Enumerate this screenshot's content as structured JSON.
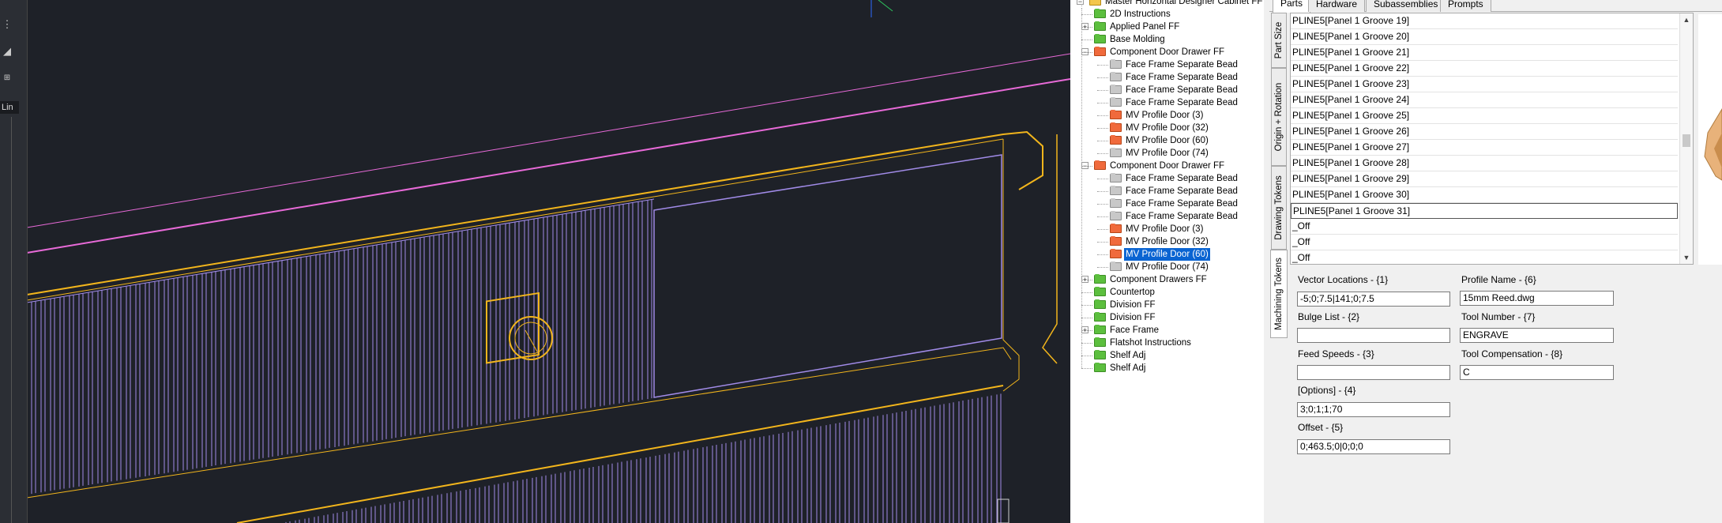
{
  "cad": {
    "linetype_label": "Lin"
  },
  "tree": {
    "root": "Master Horizontal Designer Cabinet FF",
    "nodes": [
      {
        "label": "2D Instructions",
        "color": "green",
        "expander": ""
      },
      {
        "label": "Applied Panel FF",
        "color": "green",
        "expander": "+"
      },
      {
        "label": "Base Molding",
        "color": "green",
        "expander": ""
      },
      {
        "label": "Component Door Drawer FF",
        "color": "red",
        "expander": "-"
      },
      {
        "label": "Face Frame Separate Bead",
        "color": "grey",
        "expander": ""
      },
      {
        "label": "Face Frame Separate Bead",
        "color": "grey",
        "expander": ""
      },
      {
        "label": "Face Frame Separate Bead",
        "color": "grey",
        "expander": ""
      },
      {
        "label": "Face Frame Separate Bead",
        "color": "grey",
        "expander": ""
      },
      {
        "label": "MV Profile Door (3)",
        "color": "red",
        "expander": ""
      },
      {
        "label": "MV Profile Door (32)",
        "color": "red",
        "expander": ""
      },
      {
        "label": "MV Profile Door (60)",
        "color": "red",
        "expander": ""
      },
      {
        "label": "MV Profile Door (74)",
        "color": "grey",
        "expander": ""
      },
      {
        "label": "Component Door Drawer FF",
        "color": "red",
        "expander": "-"
      },
      {
        "label": "Face Frame Separate Bead",
        "color": "grey",
        "expander": ""
      },
      {
        "label": "Face Frame Separate Bead",
        "color": "grey",
        "expander": ""
      },
      {
        "label": "Face Frame Separate Bead",
        "color": "grey",
        "expander": ""
      },
      {
        "label": "Face Frame Separate Bead",
        "color": "grey",
        "expander": ""
      },
      {
        "label": "MV Profile Door (3)",
        "color": "red",
        "expander": ""
      },
      {
        "label": "MV Profile Door (32)",
        "color": "red",
        "expander": ""
      },
      {
        "label": "MV Profile Door (60)",
        "color": "red",
        "expander": "",
        "selected": true
      },
      {
        "label": "MV Profile Door (74)",
        "color": "grey",
        "expander": ""
      },
      {
        "label": "Component Drawers FF",
        "color": "green",
        "expander": "+"
      },
      {
        "label": "Countertop",
        "color": "green",
        "expander": ""
      },
      {
        "label": "Division FF",
        "color": "green",
        "expander": ""
      },
      {
        "label": "Division FF",
        "color": "green",
        "expander": ""
      },
      {
        "label": "Face Frame",
        "color": "green",
        "expander": "+"
      },
      {
        "label": "Flatshot Instructions",
        "color": "green",
        "expander": ""
      },
      {
        "label": "Shelf Adj",
        "color": "green",
        "expander": ""
      },
      {
        "label": "Shelf Adj",
        "color": "green",
        "expander": ""
      }
    ]
  },
  "tabs": [
    "Parts",
    "Hardware",
    "Subassemblies",
    "Prompts"
  ],
  "side_tabs": [
    "Part Size",
    "Origin + Rotation",
    "Drawing Tokens",
    "Machining Tokens"
  ],
  "list": {
    "rows": [
      "PLINE5[Panel 1 Groove 19]",
      "PLINE5[Panel 1 Groove 20]",
      "PLINE5[Panel 1 Groove 21]",
      "PLINE5[Panel 1 Groove 22]",
      "PLINE5[Panel 1 Groove 23]",
      "PLINE5[Panel 1 Groove 24]",
      "PLINE5[Panel 1 Groove 25]",
      "PLINE5[Panel 1 Groove 26]",
      "PLINE5[Panel 1 Groove 27]",
      "PLINE5[Panel 1 Groove 28]",
      "PLINE5[Panel 1 Groove 29]",
      "PLINE5[Panel 1 Groove 30]",
      "PLINE5[Panel 1 Groove 31]",
      "_Off",
      "_Off",
      "_Off"
    ]
  },
  "fields": {
    "vector_locations": {
      "label": "Vector Locations - {1}",
      "value": "-5;0;7.5|141;0;7.5"
    },
    "bulge_list": {
      "label": "Bulge List - {2}",
      "value": ""
    },
    "feed_speeds": {
      "label": "Feed Speeds - {3}",
      "value": ""
    },
    "options": {
      "label": "[Options] - {4}",
      "value": "3;0;1;1;70"
    },
    "offset": {
      "label": "Offset - {5}",
      "value": "0;463.5;0|0;0;0"
    },
    "profile_name": {
      "label": "Profile Name - {6}",
      "value": "15mm Reed.dwg"
    },
    "tool_number": {
      "label": "Tool Number - {7}",
      "value": "ENGRAVE"
    },
    "tool_compensation": {
      "label": "Tool Compensation - {8}",
      "value": "C"
    }
  },
  "colors": {
    "cad_background": "#1e2128",
    "door_outline": "#f2b51c",
    "groove_lines": "#a18be8",
    "pink_lines": "#e86ad8",
    "selection": "#0a64d2"
  }
}
